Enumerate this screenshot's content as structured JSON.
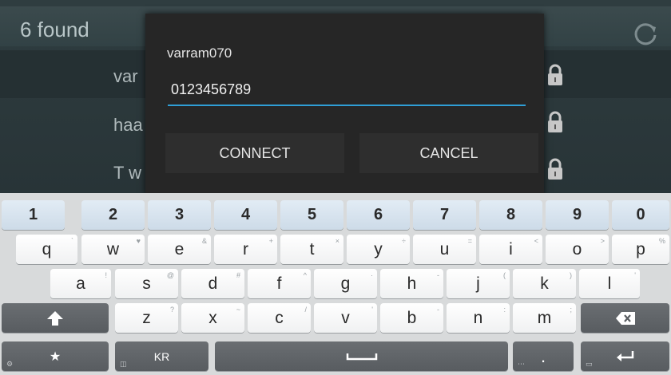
{
  "list": {
    "found_label": "6 found",
    "networks": [
      {
        "name": "var"
      },
      {
        "name": "haa"
      },
      {
        "name": "T w"
      }
    ]
  },
  "dialog": {
    "title": "varram070",
    "password_value": "0123456789",
    "connect_label": "CONNECT",
    "cancel_label": "CANCEL"
  },
  "keyboard": {
    "row_numbers": [
      "1",
      "2",
      "3",
      "4",
      "5",
      "6",
      "7",
      "8",
      "9",
      "0"
    ],
    "row_q": [
      {
        "label": "q",
        "sub": "`"
      },
      {
        "label": "w",
        "sub": "♥"
      },
      {
        "label": "e",
        "sub": "&"
      },
      {
        "label": "r",
        "sub": "+"
      },
      {
        "label": "t",
        "sub": "×"
      },
      {
        "label": "y",
        "sub": "÷"
      },
      {
        "label": "u",
        "sub": "="
      },
      {
        "label": "i",
        "sub": "<"
      },
      {
        "label": "o",
        "sub": ">"
      },
      {
        "label": "p",
        "sub": "%"
      }
    ],
    "row_a": [
      {
        "label": "a",
        "sub": "!"
      },
      {
        "label": "s",
        "sub": "@"
      },
      {
        "label": "d",
        "sub": "#"
      },
      {
        "label": "f",
        "sub": "^"
      },
      {
        "label": "g",
        "sub": "·"
      },
      {
        "label": "h",
        "sub": "-"
      },
      {
        "label": "j",
        "sub": "("
      },
      {
        "label": "k",
        "sub": ")"
      },
      {
        "label": "l",
        "sub": "'"
      }
    ],
    "row_z": [
      {
        "label": "z",
        "sub": "?"
      },
      {
        "label": "x",
        "sub": "~"
      },
      {
        "label": "c",
        "sub": "/"
      },
      {
        "label": "v",
        "sub": "'"
      },
      {
        "label": "b",
        "sub": "-"
      },
      {
        "label": "n",
        "sub": ":"
      },
      {
        "label": "m",
        "sub": ";"
      }
    ],
    "lang_label": "KR",
    "star_label": "★",
    "period_label": "."
  }
}
